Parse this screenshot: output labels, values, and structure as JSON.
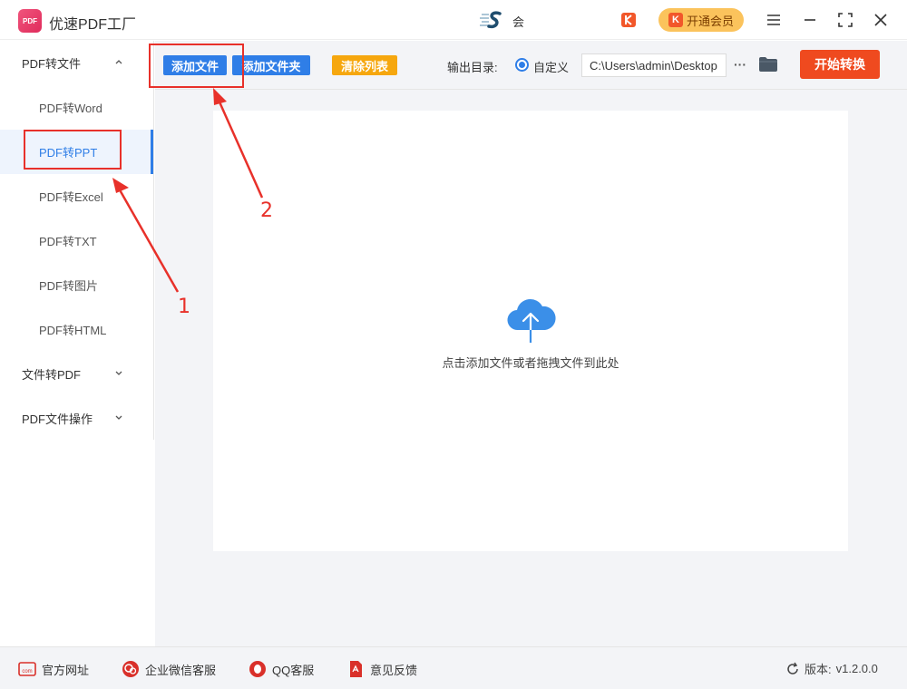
{
  "app": {
    "title": "优速PDF工厂",
    "logo_text": "PDF"
  },
  "user": {
    "name": "会"
  },
  "vip": {
    "label": "开通会员",
    "icon_text": "K"
  },
  "sidebar": {
    "groups": [
      {
        "label": "PDF转文件",
        "expanded": true,
        "icon": "chevron-up-icon"
      },
      {
        "label": "文件转PDF",
        "expanded": false,
        "icon": "chevron-down-icon"
      },
      {
        "label": "PDF文件操作",
        "expanded": false,
        "icon": "chevron-down-icon"
      }
    ],
    "items": [
      {
        "label": "PDF转Word"
      },
      {
        "label": "PDF转PPT",
        "active": true
      },
      {
        "label": "PDF转Excel"
      },
      {
        "label": "PDF转TXT"
      },
      {
        "label": "PDF转图片"
      },
      {
        "label": "PDF转HTML"
      }
    ]
  },
  "toolbar": {
    "add_file": "添加文件",
    "add_folder": "添加文件夹",
    "clear_list": "清除列表",
    "output_label": "输出目录:",
    "custom_label": "自定义",
    "path_value": "C:\\Users\\admin\\Desktop",
    "more": "···",
    "start": "开始转换"
  },
  "dropzone": {
    "hint": "点击添加文件或者拖拽文件到此处",
    "icon": "cloud-upload-icon"
  },
  "annotations": {
    "step1": "1",
    "step2": "2"
  },
  "footer": {
    "website": "官方网址",
    "wechat": "企业微信客服",
    "qq": "QQ客服",
    "feedback": "意见反馈",
    "version_label": "版本:",
    "version_value": "v1.2.0.0"
  },
  "colors": {
    "primary": "#2f7ee7",
    "orange": "#f6a70e",
    "start": "#ef4a1f",
    "annotation": "#e8312a",
    "vip": "#fbc35c"
  }
}
